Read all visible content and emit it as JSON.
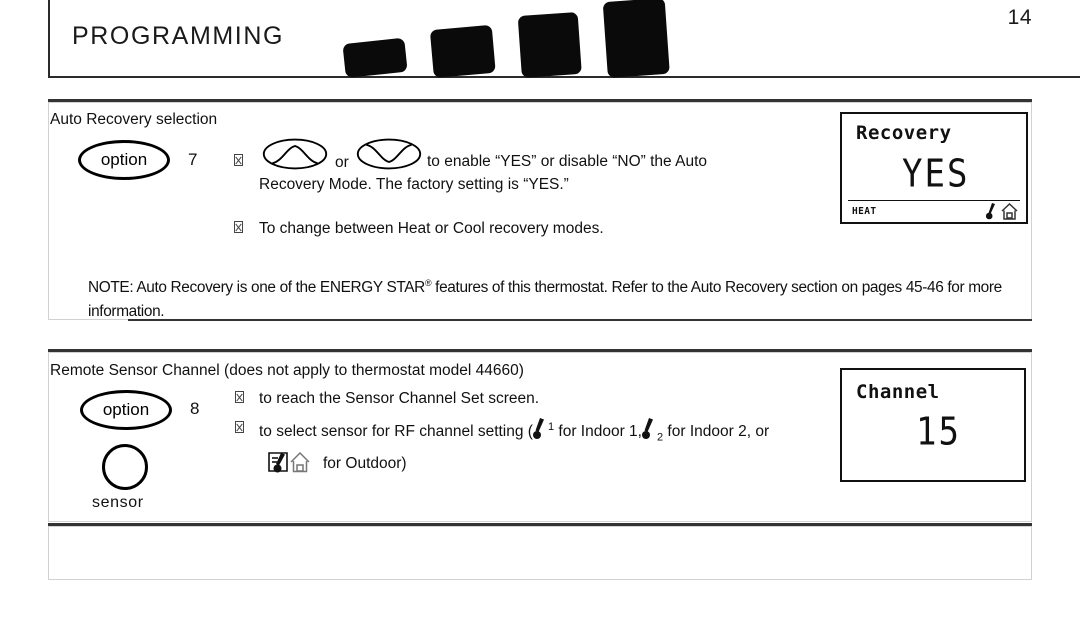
{
  "page": {
    "number": "14",
    "header_title": "PROGRAMMING"
  },
  "sections": [
    {
      "id": "auto-recovery",
      "title": "Auto Recovery selection",
      "option_label": "option",
      "step_number": "7",
      "bullets": [
        {
          "text_before": "",
          "icons": [
            "up-arrow-button",
            "or-text",
            "down-arrow-button"
          ],
          "or_label": "or",
          "text_after": "to enable “YES” or disable “NO” the Auto Recovery Mode. The factory setting is “YES.”"
        },
        {
          "text": "To change between Heat or Cool recovery modes."
        }
      ],
      "note": {
        "line1_a": "NOTE: Auto Recovery is one of the ENERGY STAR",
        "line1_sup": "®",
        "line1_b": " features of this thermostat. Refer to the Auto Recovery section on",
        "line2": "pages 45-46 for more information."
      },
      "lcd": {
        "title": "Recovery",
        "value": "YES",
        "mode": "HEAT",
        "icons": [
          "thermometer-icon",
          "house-icon"
        ]
      }
    },
    {
      "id": "remote-sensor-channel",
      "title": "Remote Sensor Channel (does not apply to thermostat model 44660)",
      "option_label": "option",
      "step_number": "8",
      "sensor_button_label": "sensor",
      "bullets": [
        {
          "text": "to reach the Sensor Channel Set screen."
        },
        {
          "part1": "to select sensor for RF channel setting (",
          "sup1": "1",
          "part2": " for Indoor 1,",
          "sub2": "2",
          "part3": " for",
          "part4": "Indoor 2, or",
          "part5": "for Outdoor)",
          "icons": [
            "thermometer-indoor1-icon",
            "thermometer-indoor2-icon",
            "outdoor-sensor-icon"
          ]
        }
      ],
      "lcd": {
        "title": "Channel",
        "value": "15"
      }
    }
  ],
  "colors": {
    "ink": "#111111",
    "rule": "#333333",
    "panel_border": "#d2d2d2",
    "deco": "#0a0a0a"
  }
}
